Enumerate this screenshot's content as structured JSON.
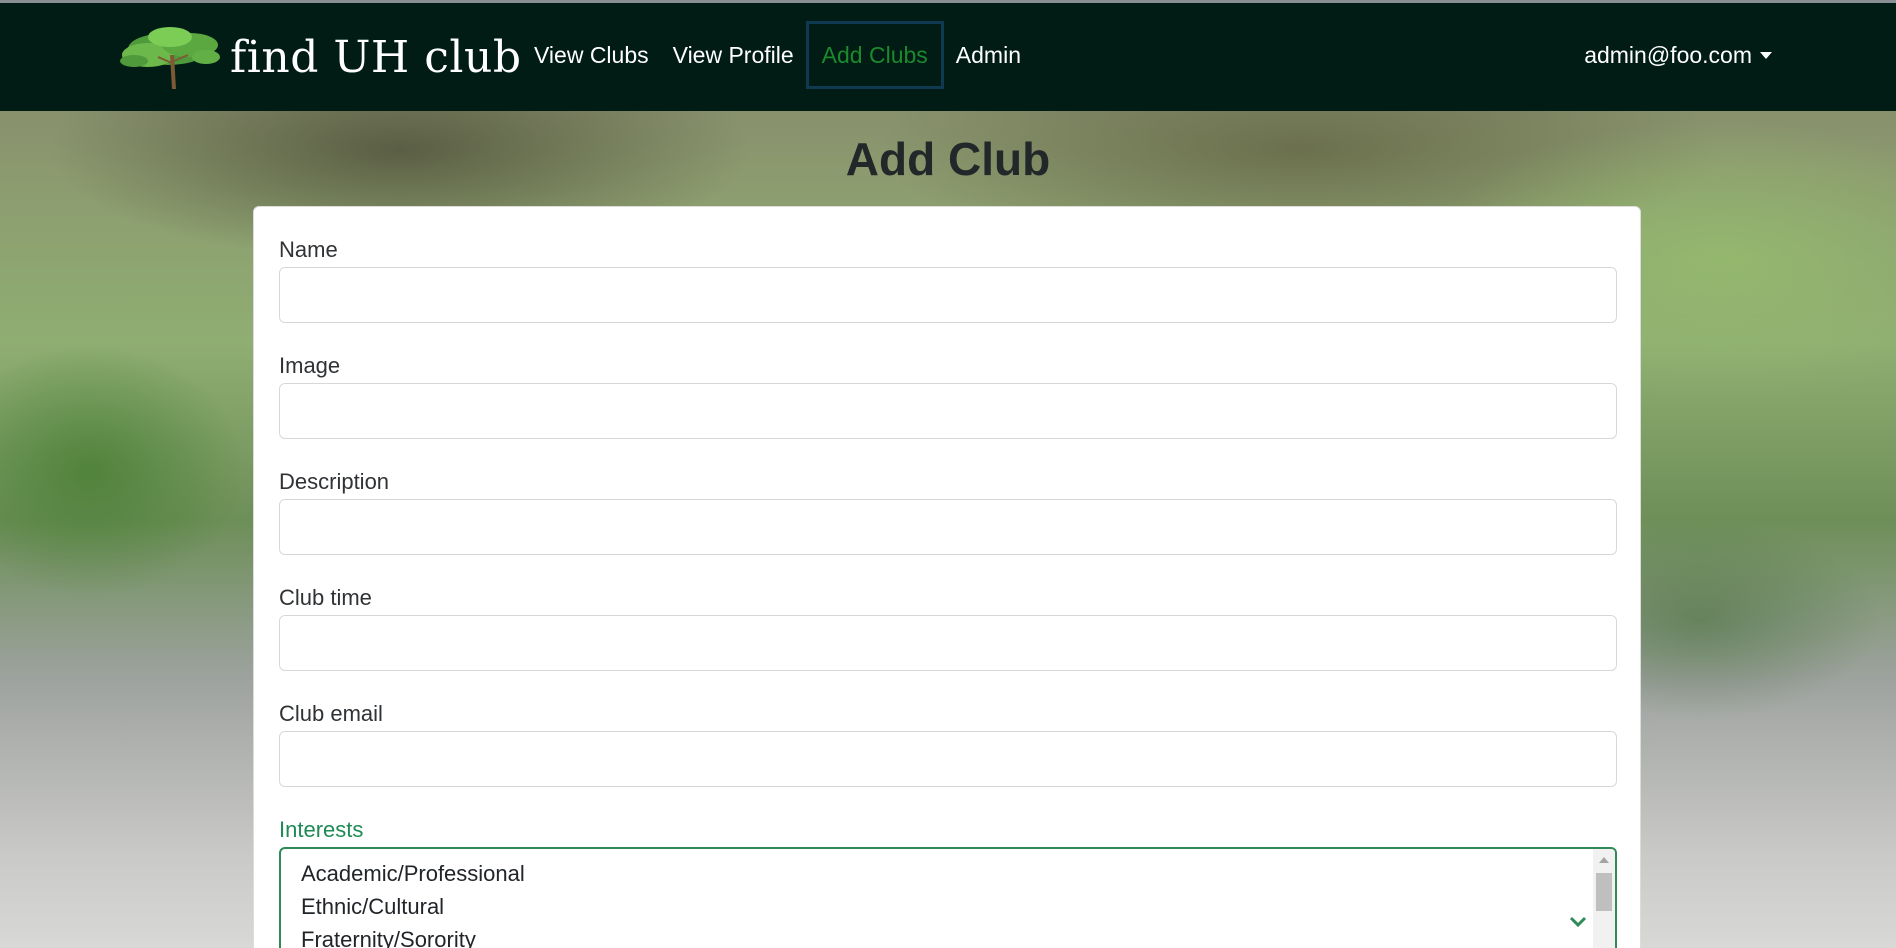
{
  "brand": {
    "name": "find UH club",
    "logo_icon": "tree-logo-icon"
  },
  "nav": {
    "items": [
      {
        "label": "View Clubs"
      },
      {
        "label": "View Profile"
      },
      {
        "label": "Add Clubs",
        "active": true
      },
      {
        "label": "Admin"
      }
    ],
    "user": "admin@foo.com",
    "user_icon": "caret-down-icon"
  },
  "page": {
    "title": "Add Club"
  },
  "form": {
    "name_label": "Name",
    "name_value": "",
    "image_label": "Image",
    "image_value": "",
    "description_label": "Description",
    "description_value": "",
    "club_time_label": "Club time",
    "club_time_value": "",
    "club_email_label": "Club email",
    "club_email_value": "",
    "interests_label": "Interests",
    "interests_options": [
      "Academic/Professional",
      "Ethnic/Cultural",
      "Fraternity/Sorority"
    ]
  },
  "colors": {
    "navbar": "#001c15",
    "active_link": "#1a8a2c",
    "focus": "#2e8b57"
  }
}
